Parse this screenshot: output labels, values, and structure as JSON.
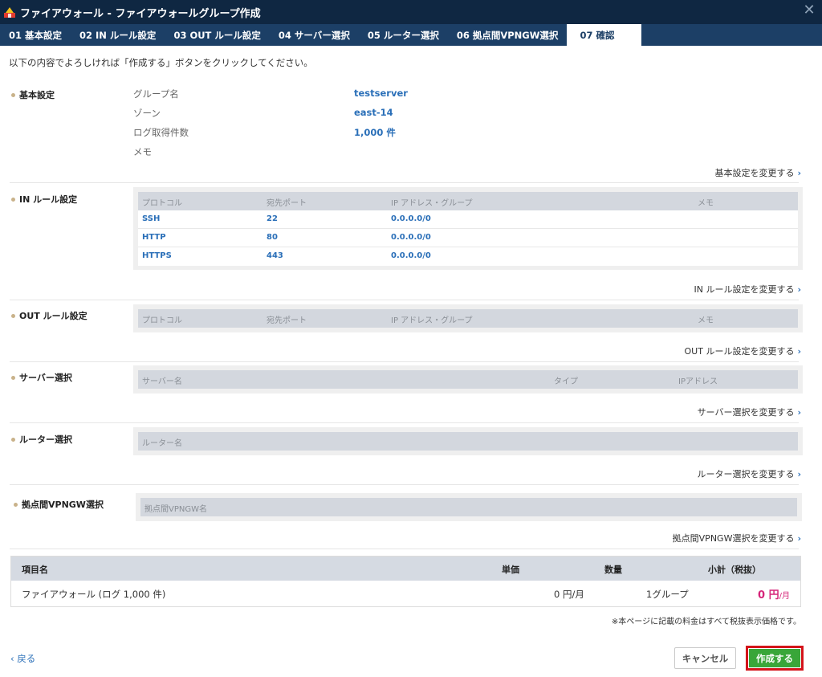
{
  "window": {
    "title": "ファイアウォール - ファイアウォールグループ作成",
    "close_glyph": "✕"
  },
  "tabs": [
    {
      "label": "01 基本設定"
    },
    {
      "label": "02 IN ルール設定"
    },
    {
      "label": "03 OUT ルール設定"
    },
    {
      "label": "04 サーバー選択"
    },
    {
      "label": "05 ルーター選択"
    },
    {
      "label": "06 拠点間VPNGW選択"
    },
    {
      "label": "07 確認",
      "active": true
    }
  ],
  "intro": "以下の内容でよろしければ「作成する」ボタンをクリックしてください。",
  "basic": {
    "heading": "基本設定",
    "fields": [
      {
        "label": "グループ名",
        "value": "testserver"
      },
      {
        "label": "ゾーン",
        "value": "east-14"
      },
      {
        "label": "ログ取得件数",
        "value": "1,000 件"
      },
      {
        "label": "メモ",
        "value": ""
      }
    ],
    "change_link": "基本設定を変更する"
  },
  "in_rules": {
    "heading": "IN ルール設定",
    "columns": [
      "プロトコル",
      "宛先ポート",
      "IP アドレス・グループ",
      "メモ"
    ],
    "rows": [
      {
        "protocol": "SSH",
        "port": "22",
        "ip": "0.0.0.0/0",
        "memo": ""
      },
      {
        "protocol": "HTTP",
        "port": "80",
        "ip": "0.0.0.0/0",
        "memo": ""
      },
      {
        "protocol": "HTTPS",
        "port": "443",
        "ip": "0.0.0.0/0",
        "memo": ""
      }
    ],
    "change_link": "IN ルール設定を変更する"
  },
  "out_rules": {
    "heading": "OUT ルール設定",
    "columns": [
      "プロトコル",
      "宛先ポート",
      "IP アドレス・グループ",
      "メモ"
    ],
    "change_link": "OUT ルール設定を変更する"
  },
  "servers": {
    "heading": "サーバー選択",
    "columns": [
      "サーバー名",
      "タイプ",
      "IPアドレス"
    ],
    "change_link": "サーバー選択を変更する"
  },
  "routers": {
    "heading": "ルーター選択",
    "columns": [
      "ルーター名"
    ],
    "change_link": "ルーター選択を変更する"
  },
  "vpngw": {
    "heading": "拠点間VPNGW選択",
    "columns": [
      "拠点間VPNGW名"
    ],
    "change_link": "拠点間VPNGW選択を変更する"
  },
  "summary": {
    "columns": [
      "項目名",
      "単価",
      "数量",
      "小計（税抜）"
    ],
    "rows": [
      {
        "item": "ファイアウォール (ログ 1,000 件)",
        "unit_price": "0 円/月",
        "quantity": "1グループ",
        "subtotal_amount": "0 円",
        "subtotal_unit": "/月"
      }
    ],
    "note": "※本ページに記載の料金はすべて税抜表示価格です。"
  },
  "footer": {
    "back": "戻る",
    "cancel": "キャンセル",
    "create": "作成する"
  },
  "colors": {
    "titlebar": "#0f2742",
    "tabbar": "#1c3f66",
    "link_blue": "#2a6fb8",
    "price_pink": "#d6257a",
    "create_green": "#39a639",
    "highlight_red": "#d4141b"
  }
}
